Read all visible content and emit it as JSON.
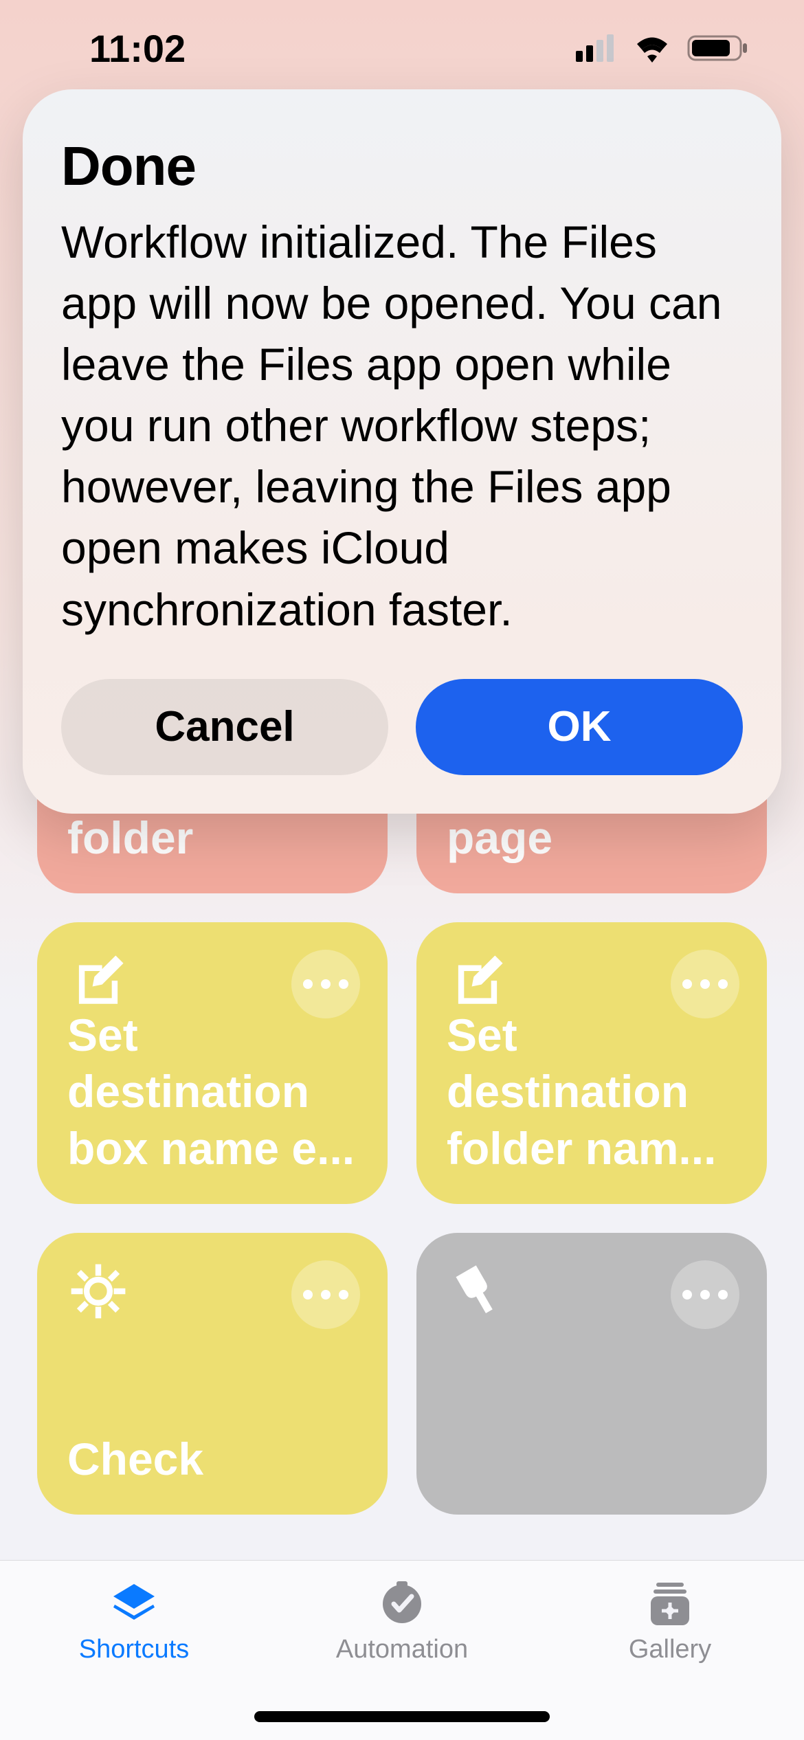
{
  "status": {
    "time": "11:02"
  },
  "dialog": {
    "title": "Done",
    "body": "Workflow initialized. The Files app will now be opened. You can leave the Files app open while you run other workflow steps; however, leaving the Files app open makes iCloud synchronization faster.",
    "cancel": "Cancel",
    "ok": "OK"
  },
  "cards": {
    "c0": "Start new\ndestination\nfolder",
    "c1": "Take photo\nof document\npage",
    "c2": "Set\ndestination\nbox name e...",
    "c3": "Set\ndestination\nfolder nam...",
    "c4": "Check",
    "c5": ""
  },
  "tabs": {
    "shortcuts": "Shortcuts",
    "automation": "Automation",
    "gallery": "Gallery"
  }
}
